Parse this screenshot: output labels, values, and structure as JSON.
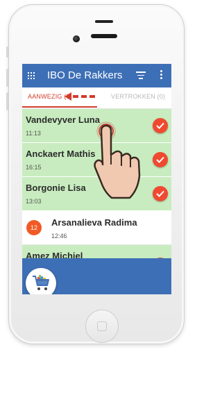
{
  "app": {
    "title": "IBO De Rakkers"
  },
  "tabs": [
    {
      "label": "AANWEZIG (6)",
      "active": true
    },
    {
      "label": "VERTROKKEN (0)",
      "active": false
    }
  ],
  "children": [
    {
      "name": "Vandevyver Luna",
      "time": "11:13",
      "status": "present"
    },
    {
      "name": "Anckaert Mathis",
      "time": "16:15",
      "status": "present"
    },
    {
      "name": "Borgonie Lisa",
      "time": "13:03",
      "status": "present"
    },
    {
      "name": "Arsanalieva Radima",
      "time": "12:46",
      "status": "absent",
      "badge": "12"
    },
    {
      "name": "Amez Michiel",
      "time": "",
      "status": "present"
    }
  ],
  "colors": {
    "appbar": "#3d6fb6",
    "present_row": "#c8ecbf",
    "accent": "#d33b2c",
    "check_button": "#ef4a30",
    "badge": "#f15a25"
  },
  "icons": {
    "menu": "grid-menu-icon",
    "filter": "filter-icon",
    "more": "more-vert-icon",
    "check": "check-icon",
    "cart": "shopping-cart-icon",
    "hand": "pointing-hand-icon",
    "arrow": "swipe-left-arrow-icon"
  }
}
